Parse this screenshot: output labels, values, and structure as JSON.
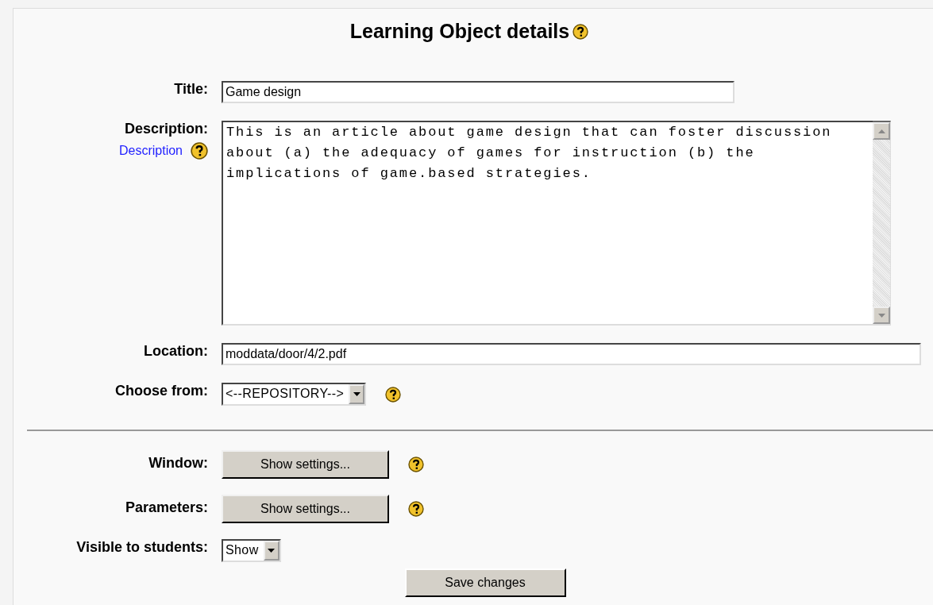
{
  "heading": "Learning Object details",
  "fields": [
    {
      "kind": "text",
      "label": "Title:",
      "value": "Game design"
    },
    {
      "kind": "textarea",
      "label": "Description:",
      "help_link": "Description",
      "value": "This is an article about game design that can foster discussion about (a) the adequacy of games for instruction (b) the implications of game.based strategies."
    },
    {
      "kind": "wide_text",
      "label": "Location:",
      "value": "moddata/door/4/2.pdf"
    },
    {
      "kind": "select",
      "label": "Choose from:",
      "value": "<--REPOSITORY-->",
      "help": true
    },
    {
      "kind": "divider"
    },
    {
      "kind": "button",
      "label": "Window:",
      "value": "Show settings...",
      "help": true
    },
    {
      "kind": "button",
      "label": "Parameters:",
      "value": "Show settings...",
      "help": true
    },
    {
      "kind": "select",
      "label": "Visible to students:",
      "value": "Show",
      "help": false
    }
  ],
  "submit": "Save changes"
}
